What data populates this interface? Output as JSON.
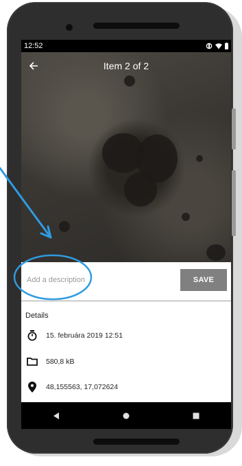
{
  "status_bar": {
    "time": "12:52",
    "icons": [
      "nfc-icon",
      "wifi-icon",
      "battery-icon"
    ]
  },
  "app_bar": {
    "back_icon": "arrow-back-icon",
    "title": "Item 2 of 2"
  },
  "description": {
    "placeholder": "Add a description",
    "value": ""
  },
  "save_label": "SAVE",
  "details": {
    "heading": "Details",
    "items": [
      {
        "icon": "timer-icon",
        "text": "15. februára 2019 12:51"
      },
      {
        "icon": "folder-icon",
        "text": "580,8 kB"
      },
      {
        "icon": "location-pin-icon",
        "text": "48,155563, 17,072624"
      }
    ]
  },
  "navigation": [
    "back-triangle-icon",
    "home-circle-icon",
    "recents-square-icon"
  ],
  "colors": {
    "annotation": "#2f9be0",
    "save_button": "#808080",
    "status_bar": "#000000"
  }
}
